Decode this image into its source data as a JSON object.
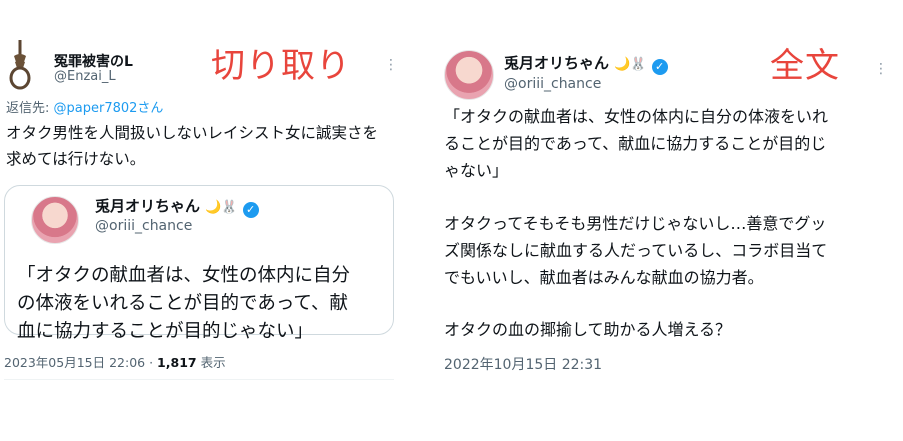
{
  "left": {
    "annotation": "切り取り",
    "tweet": {
      "display_name": "冤罪被害のL",
      "handle": "@Enzai_L",
      "reply_prefix": "返信先: ",
      "reply_mention": "@paper7802",
      "reply_suffix": "さん",
      "body_line1": "オタク男性を人間扱いしないレイシスト女に誠実さを",
      "body_line2": "求めては行けない。"
    },
    "quote": {
      "display_name": "兎月オリちゃん",
      "emojis": "🌙🐰",
      "handle": "@oriii_chance",
      "line1": "「オタクの献血者は、女性の体内に自分",
      "line2": "の体液をいれることが目的であって、献",
      "line3": "血に協力することが目的じゃない」"
    },
    "timestamp": "2023年05月15日 22:06",
    "separator": " · ",
    "views_count": "1,817",
    "views_label": " 表示"
  },
  "right": {
    "annotation": "全文",
    "tweet": {
      "display_name": "兎月オリちゃん",
      "emojis": "🌙🐰",
      "handle": "@oriii_chance",
      "p1_line1": "「オタクの献血者は、女性の体内に自分の体液をいれ",
      "p1_line2": "ることが目的であって、献血に協力することが目的じ",
      "p1_line3": "ゃない」",
      "p2_line1": "オタクってそもそも男性だけじゃないし…善意でグッ",
      "p2_line2": "ズ関係なしに献血する人だっているし、コラボ目当て",
      "p2_line3": "でもいいし、献血者はみんな献血の協力者。",
      "p3_line1": "オタクの血の揶揄して助かる人増える？",
      "timestamp": "2022年10月15日 22:31"
    }
  },
  "icons": {
    "more": "⋮",
    "verified": "✓"
  },
  "colors": {
    "annotation": "#e8453c",
    "link": "#1d9bf0",
    "verified": "#1d9bf0",
    "secondary_text": "#536471"
  }
}
